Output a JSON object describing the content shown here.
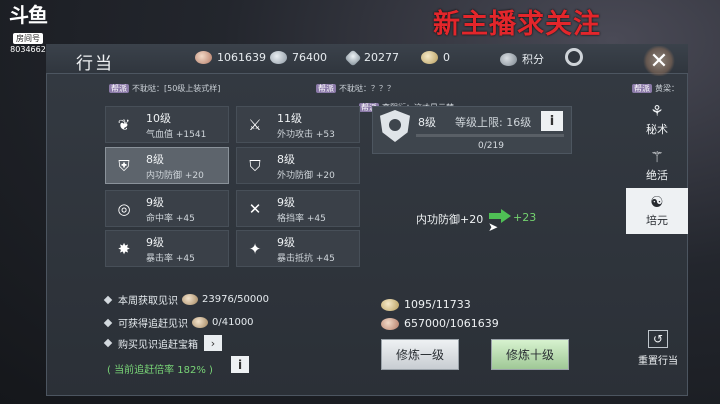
{
  "stream": {
    "logo": "斗鱼",
    "room_label": "房间号",
    "room_number": "8034662",
    "promo": "新主播求关注"
  },
  "window": {
    "title": "行当"
  },
  "resources": [
    {
      "icon": "coin-icon",
      "value": "1061639"
    },
    {
      "icon": "silver-icon",
      "value": "76400"
    },
    {
      "icon": "spark-icon",
      "value": "20277"
    },
    {
      "icon": "bag-icon",
      "value": "0"
    },
    {
      "icon": "score-icon",
      "value": "积分"
    }
  ],
  "chat": [
    {
      "tag": "帮派",
      "text": "不耽哒：[50级上装式样]"
    },
    {
      "tag": "帮派",
      "text": "不耽哒：？？？"
    },
    {
      "tag": "帮派",
      "text": "李熙衍：这才是云梦"
    },
    {
      "tag": "帮派",
      "text": "黄梁："
    }
  ],
  "stats": [
    {
      "icon": "heart-hands-icon",
      "level": "10级",
      "attr": "气血值 +1541"
    },
    {
      "icon": "sword-icon",
      "level": "11级",
      "attr": "外功攻击 +53"
    },
    {
      "icon": "shield-icon",
      "level": "8级",
      "attr": "内功防御 +20"
    },
    {
      "icon": "guard-icon",
      "level": "8级",
      "attr": "外功防御 +20"
    },
    {
      "icon": "target-icon",
      "level": "9级",
      "attr": "命中率 +45"
    },
    {
      "icon": "cross-swords-icon",
      "level": "9级",
      "attr": "格挡率 +45"
    },
    {
      "icon": "burst-icon",
      "level": "9级",
      "attr": "暴击率 +45"
    },
    {
      "icon": "resist-icon",
      "level": "9级",
      "attr": "暴击抵抗 +45"
    }
  ],
  "detail": {
    "level": "8级",
    "cap": "等级上限: 16级",
    "progress_text": "0/219",
    "progress": 0,
    "current": "内功防御+20",
    "next": "+23",
    "cost1": "1095/11733",
    "cost2": "657000/1061639",
    "train_one": "修炼一级",
    "train_ten": "修炼十级"
  },
  "info_rows": {
    "weekly": "本周获取见识",
    "weekly_value": "23976/50000",
    "catchup": "可获得追赶见识",
    "catchup_value": "0/41000",
    "buy": "购买见识追赶宝箱",
    "ratio": "( 当前追赶倍率 182% )"
  },
  "sidebar": [
    {
      "icon": "scroll-icon",
      "label": "秘术"
    },
    {
      "icon": "blade-icon",
      "label": "绝活"
    },
    {
      "icon": "cultivate-icon",
      "label": "培元"
    }
  ],
  "reset_label": "重置行当",
  "colors": {
    "accent_green": "#74d26f",
    "promo_red": "#e3262b"
  }
}
